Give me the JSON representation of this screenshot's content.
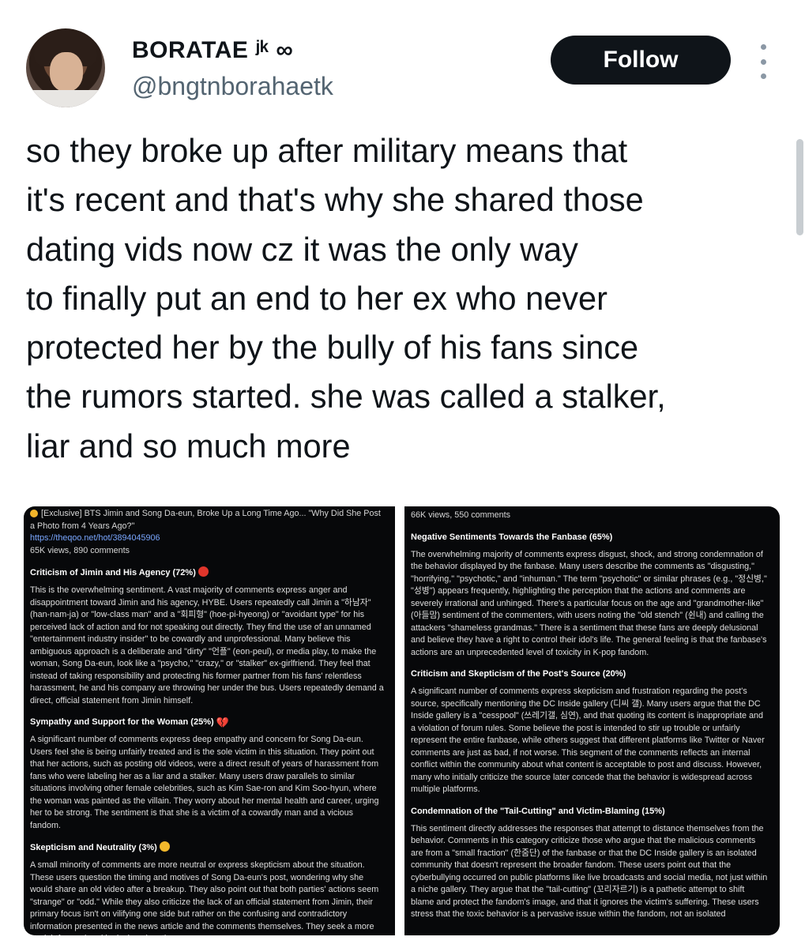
{
  "header": {
    "display_name": "BORATAE ʲᵏ ∞",
    "handle": "@bngtnborahaetk",
    "follow_label": "Follow"
  },
  "tweet": {
    "lines": [
      "so they broke up after military means that",
      "it's recent and that's why she shared those",
      "dating vids now cz it was the only way",
      "to finally put an end to her ex who never",
      "protected her by the bully of his fans since",
      "the rumors started. she was called a stalker,",
      "liar and so much more"
    ]
  },
  "image_left": {
    "title": "[Exclusive] BTS Jimin and Song Da-eun, Broke Up a Long Time Ago... \"Why Did She Post a Photo from 4 Years Ago?\"",
    "url": "https://theqoo.net/hot/3894045906",
    "stats": "65K views, 890 comments",
    "sections": [
      {
        "heading": "Criticism of Jimin and His Agency (72%)",
        "body": "This is the overwhelming sentiment. A vast majority of comments express anger and disappointment toward Jimin and his agency, HYBE. Users repeatedly call Jimin a \"하남자\" (han-nam-ja) or \"low-class man\" and a \"회피형\" (hoe-pi-hyeong) or \"avoidant type\" for his perceived lack of action and for not speaking out directly. They find the use of an unnamed \"entertainment industry insider\" to be cowardly and unprofessional. Many believe this ambiguous approach is a deliberate and \"dirty\" \"언플\" (eon-peul), or media play, to make the woman, Song Da-eun, look like a \"psycho,\" \"crazy,\" or \"stalker\" ex-girlfriend. They feel that instead of taking responsibility and protecting his former partner from his fans' relentless harassment, he and his company are throwing her under the bus. Users repeatedly demand a direct, official statement from Jimin himself."
      },
      {
        "heading": "Sympathy and Support for the Woman (25%)",
        "body": "A significant number of comments express deep empathy and concern for Song Da-eun. Users feel she is being unfairly treated and is the sole victim in this situation. They point out that her actions, such as posting old videos, were a direct result of years of harassment from fans who were labeling her as a liar and a stalker. Many users draw parallels to similar situations involving other female celebrities, such as Kim Sae-ron and Kim Soo-hyun, where the woman was painted as the villain. They worry about her mental health and career, urging her to be strong. The sentiment is that she is a victim of a cowardly man and a vicious fandom."
      },
      {
        "heading": "Skepticism and Neutrality (3%)",
        "body": "A small minority of comments are more neutral or express skepticism about the situation. These users question the timing and motives of Song Da-eun's post, wondering why she would share an old video after a breakup. They also point out that both parties' actions seem \"strange\" or \"odd.\" While they also criticize the lack of an official statement from Jimin, their primary focus isn't on vilifying one side but rather on the confusing and contradictory information presented in the news article and the comments themselves. They seek a more straightforward and logical explanation."
      }
    ]
  },
  "image_right": {
    "stats": "66K views, 550 comments",
    "sections": [
      {
        "heading": "Negative Sentiments Towards the Fanbase (65%)",
        "body": "The overwhelming majority of comments express disgust, shock, and strong condemnation of the behavior displayed by the fanbase. Many users describe the comments as \"disgusting,\" \"horrifying,\" \"psychotic,\" and \"inhuman.\" The term \"psychotic\" or similar phrases (e.g., \"정신병,\" \"성병\") appears frequently, highlighting the perception that the actions and comments are severely irrational and unhinged. There's a particular focus on the age and \"grandmother-like\" (아들맘) sentiment of the commenters, with users noting the \"old stench\" (쉰내) and calling the attackers \"shameless grandmas.\" There is a sentiment that these fans are deeply delusional and believe they have a right to control their idol's life. The general feeling is that the fanbase's actions are an unprecedented level of toxicity in K-pop fandom."
      },
      {
        "heading": "Criticism and Skepticism of the Post's Source (20%)",
        "body": "A significant number of comments express skepticism and frustration regarding the post's source, specifically mentioning the DC Inside gallery (디씨 갤). Many users argue that the DC Inside gallery is a \"cesspool\" (쓰레기갤, 심연), and that quoting its content is inappropriate and a violation of forum rules. Some believe the post is intended to stir up trouble or unfairly represent the entire fanbase, while others suggest that different platforms like Twitter or Naver comments are just as bad, if not worse. This segment of the comments reflects an internal conflict within the community about what content is acceptable to post and discuss. However, many who initially criticize the source later concede that the behavior is widespread across multiple platforms."
      },
      {
        "heading": "Condemnation of the \"Tail-Cutting\" and Victim-Blaming (15%)",
        "body": "This sentiment directly addresses the responses that attempt to distance themselves from the behavior. Comments in this category criticize those who argue that the malicious comments are from a \"small fraction\" (한줌단) of the fanbase or that the DC Inside gallery is an isolated community that doesn't represent the broader fandom. These users point out that the cyberbullying occurred on public platforms like live broadcasts and social media, not just within a niche gallery. They argue that the \"tail-cutting\" (꼬리자르기) is a pathetic attempt to shift blame and protect the fandom's image, and that it ignores the victim's suffering. These users stress that the toxic behavior is a pervasive issue within the fandom, not an isolated"
      }
    ]
  },
  "colors": {
    "text": "#0f1419",
    "handle": "#536471",
    "follow_bg": "#0f1419",
    "card_bg": "#07080a",
    "link": "#7aa7ff"
  }
}
